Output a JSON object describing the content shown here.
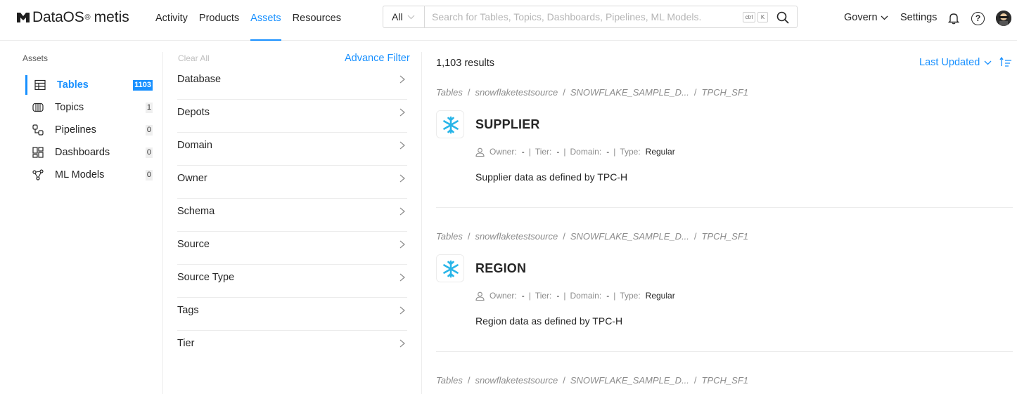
{
  "header": {
    "logo_text": "DataOS",
    "logo_sup": "®",
    "logo_sub": "metis",
    "nav": [
      "Activity",
      "Products",
      "Assets",
      "Resources"
    ],
    "active_nav": "Assets",
    "search": {
      "scope": "All",
      "placeholder": "Search for Tables, Topics, Dashboards, Pipelines, ML Models.",
      "kbd_ctrl": "ctrl",
      "kbd_k": "K"
    },
    "govern_label": "Govern",
    "settings_label": "Settings",
    "help_label": "?"
  },
  "sidebar": {
    "title": "Assets",
    "items": [
      {
        "label": "Tables",
        "count": "1103",
        "icon": "table-icon",
        "active": true
      },
      {
        "label": "Topics",
        "count": "1",
        "icon": "topic-icon",
        "active": false
      },
      {
        "label": "Pipelines",
        "count": "0",
        "icon": "pipeline-icon",
        "active": false
      },
      {
        "label": "Dashboards",
        "count": "0",
        "icon": "dashboard-icon",
        "active": false
      },
      {
        "label": "ML Models",
        "count": "0",
        "icon": "ml-model-icon",
        "active": false
      }
    ]
  },
  "filters": {
    "clear_all": "Clear All",
    "advance_filter": "Advance Filter",
    "items": [
      "Database",
      "Depots",
      "Domain",
      "Owner",
      "Schema",
      "Source",
      "Source Type",
      "Tags",
      "Tier"
    ]
  },
  "results": {
    "count_text": "1,103 results",
    "sort_label": "Last Updated",
    "cards": [
      {
        "breadcrumb": [
          "Tables",
          "snowflaketestsource",
          "SNOWFLAKE_SAMPLE_D...",
          "TPCH_SF1"
        ],
        "name": "SUPPLIER",
        "owner_label": "Owner:",
        "owner": "-",
        "tier_label": "Tier:",
        "tier": "-",
        "domain_label": "Domain:",
        "domain": "-",
        "type_label": "Type:",
        "type": "Regular",
        "description": "Supplier data as defined by TPC-H"
      },
      {
        "breadcrumb": [
          "Tables",
          "snowflaketestsource",
          "SNOWFLAKE_SAMPLE_D...",
          "TPCH_SF1"
        ],
        "name": "REGION",
        "owner_label": "Owner:",
        "owner": "-",
        "tier_label": "Tier:",
        "tier": "-",
        "domain_label": "Domain:",
        "domain": "-",
        "type_label": "Type:",
        "type": "Regular",
        "description": "Region data as defined by TPC-H"
      },
      {
        "breadcrumb": [
          "Tables",
          "snowflaketestsource",
          "SNOWFLAKE_SAMPLE_D...",
          "TPCH_SF1"
        ]
      }
    ]
  },
  "colors": {
    "accent": "#1890ff",
    "snowflake": "#29b5e8"
  }
}
